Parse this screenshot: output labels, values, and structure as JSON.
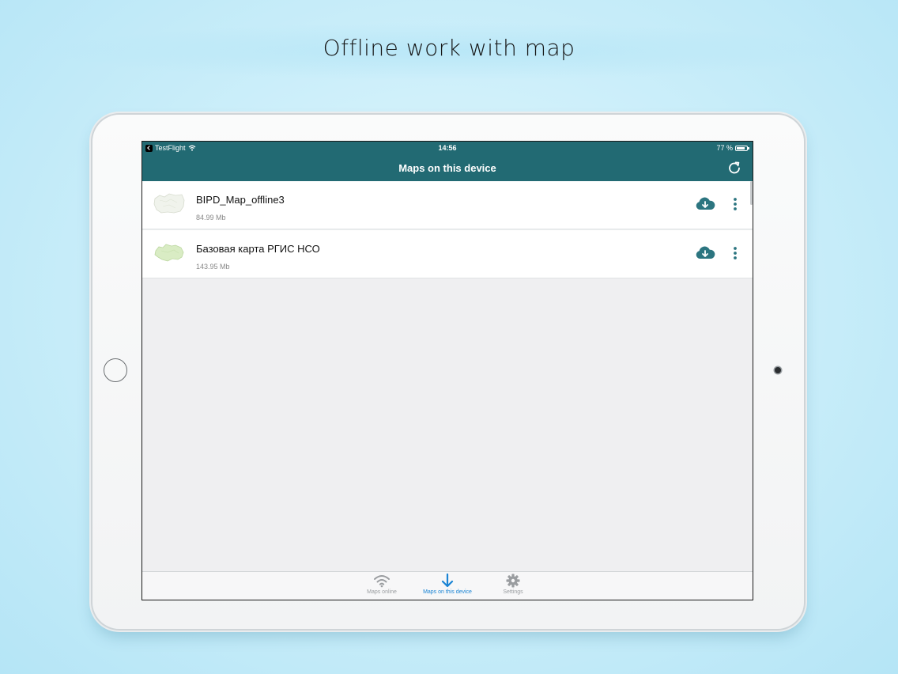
{
  "headline": "Offline work with map",
  "status_bar": {
    "app": "TestFlight",
    "time": "14:56",
    "battery": "77 %"
  },
  "nav": {
    "title": "Maps on this device"
  },
  "maps": [
    {
      "name": "BIPD_Map_offline3",
      "size": "84.99 Mb"
    },
    {
      "name": "Базовая карта РГИС НСО",
      "size": "143.95 Mb"
    }
  ],
  "tabs": [
    {
      "label": "Maps online",
      "icon": "wifi-icon",
      "active": false
    },
    {
      "label": "Maps on this device",
      "icon": "download-arrow-icon",
      "active": true
    },
    {
      "label": "Settings",
      "icon": "gear-icon",
      "active": false
    }
  ],
  "colors": {
    "header": "#226a73",
    "accent": "#1a84d4",
    "icon_teal": "#2c7580"
  }
}
